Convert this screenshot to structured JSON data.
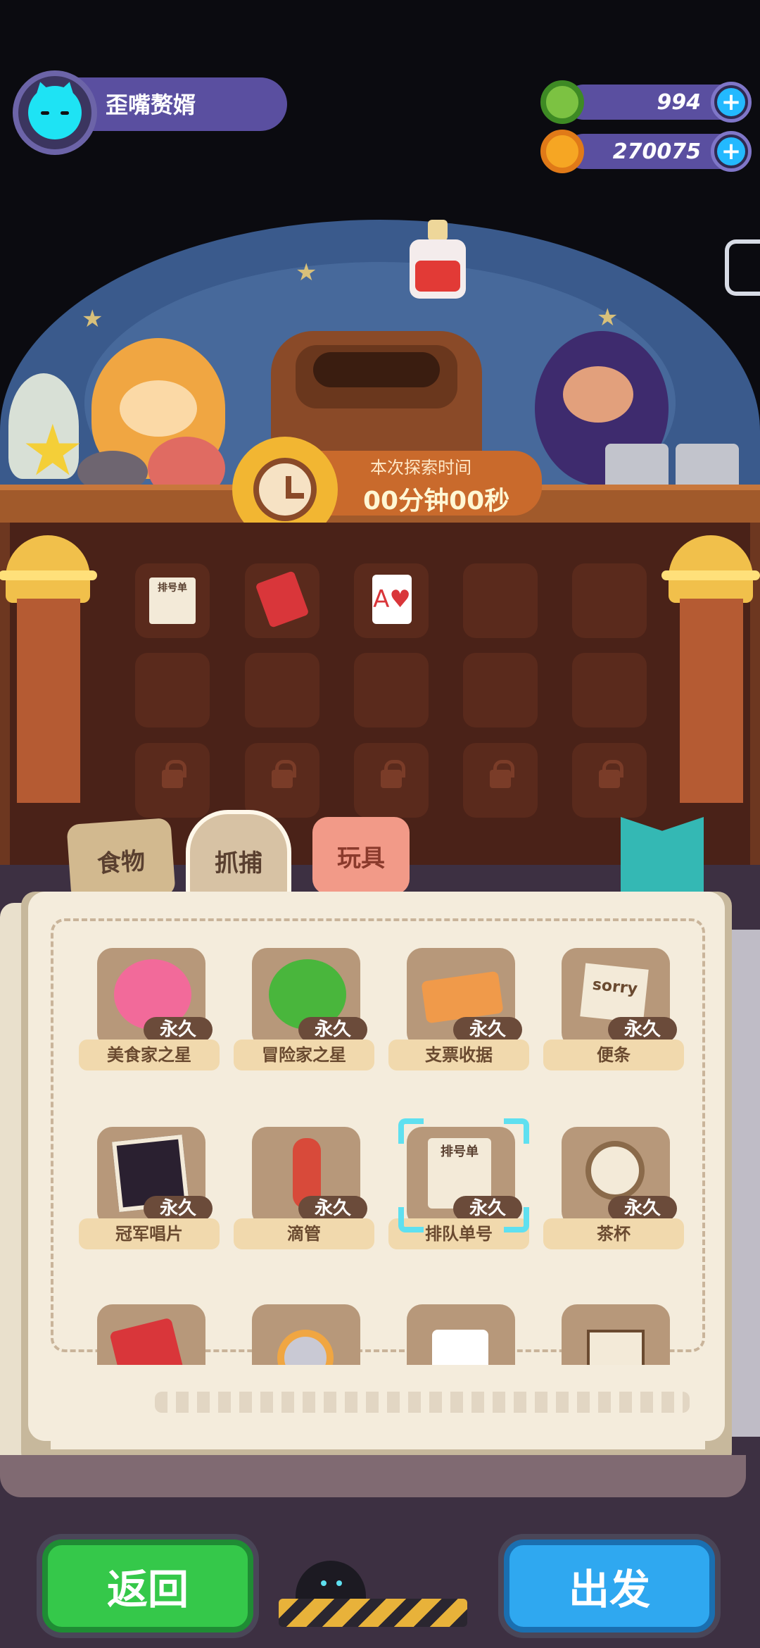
{
  "player": {
    "name": "歪嘴赘婿"
  },
  "currencies": [
    {
      "name": "green-donut",
      "value": "994",
      "color": "#7cc242"
    },
    {
      "name": "gold-planet-coin",
      "value": "270075",
      "color": "#f6a623"
    }
  ],
  "expedition": {
    "time_label": "本次探索时间",
    "time_value": "00分钟00秒"
  },
  "cabinet_slots": [
    {
      "item": "queue-ticket",
      "text": "排号单"
    },
    {
      "item": "red-book"
    },
    {
      "item": "heart-card",
      "text": "A♥"
    }
  ],
  "tabs": [
    {
      "label": "食物"
    },
    {
      "label": "抓捕",
      "active": true
    },
    {
      "label": "玩具"
    }
  ],
  "inventory": [
    {
      "name": "美食家之星",
      "duration": "永久",
      "icon": "gourmet-star-badge-icon"
    },
    {
      "name": "冒险家之星",
      "duration": "永久",
      "icon": "adventurer-star-badge-icon"
    },
    {
      "name": "支票收据",
      "duration": "永久",
      "icon": "cheque-receipt-icon"
    },
    {
      "name": "便条",
      "duration": "永久",
      "icon": "note-icon",
      "text": "sorry"
    },
    {
      "name": "冠军唱片",
      "duration": "永久",
      "icon": "champion-record-icon"
    },
    {
      "name": "滴管",
      "duration": "永久",
      "icon": "dropper-icon"
    },
    {
      "name": "排队单号",
      "duration": "永久",
      "icon": "queue-number-icon",
      "selected": true,
      "text": "排号单"
    },
    {
      "name": "茶杯",
      "duration": "永久",
      "icon": "teacup-icon"
    }
  ],
  "buttons": {
    "back": "返回",
    "go": "出发"
  },
  "colors": {
    "accent_green": "#35c84a",
    "accent_blue": "#2fa8f0",
    "selection": "#5fe0f0"
  }
}
